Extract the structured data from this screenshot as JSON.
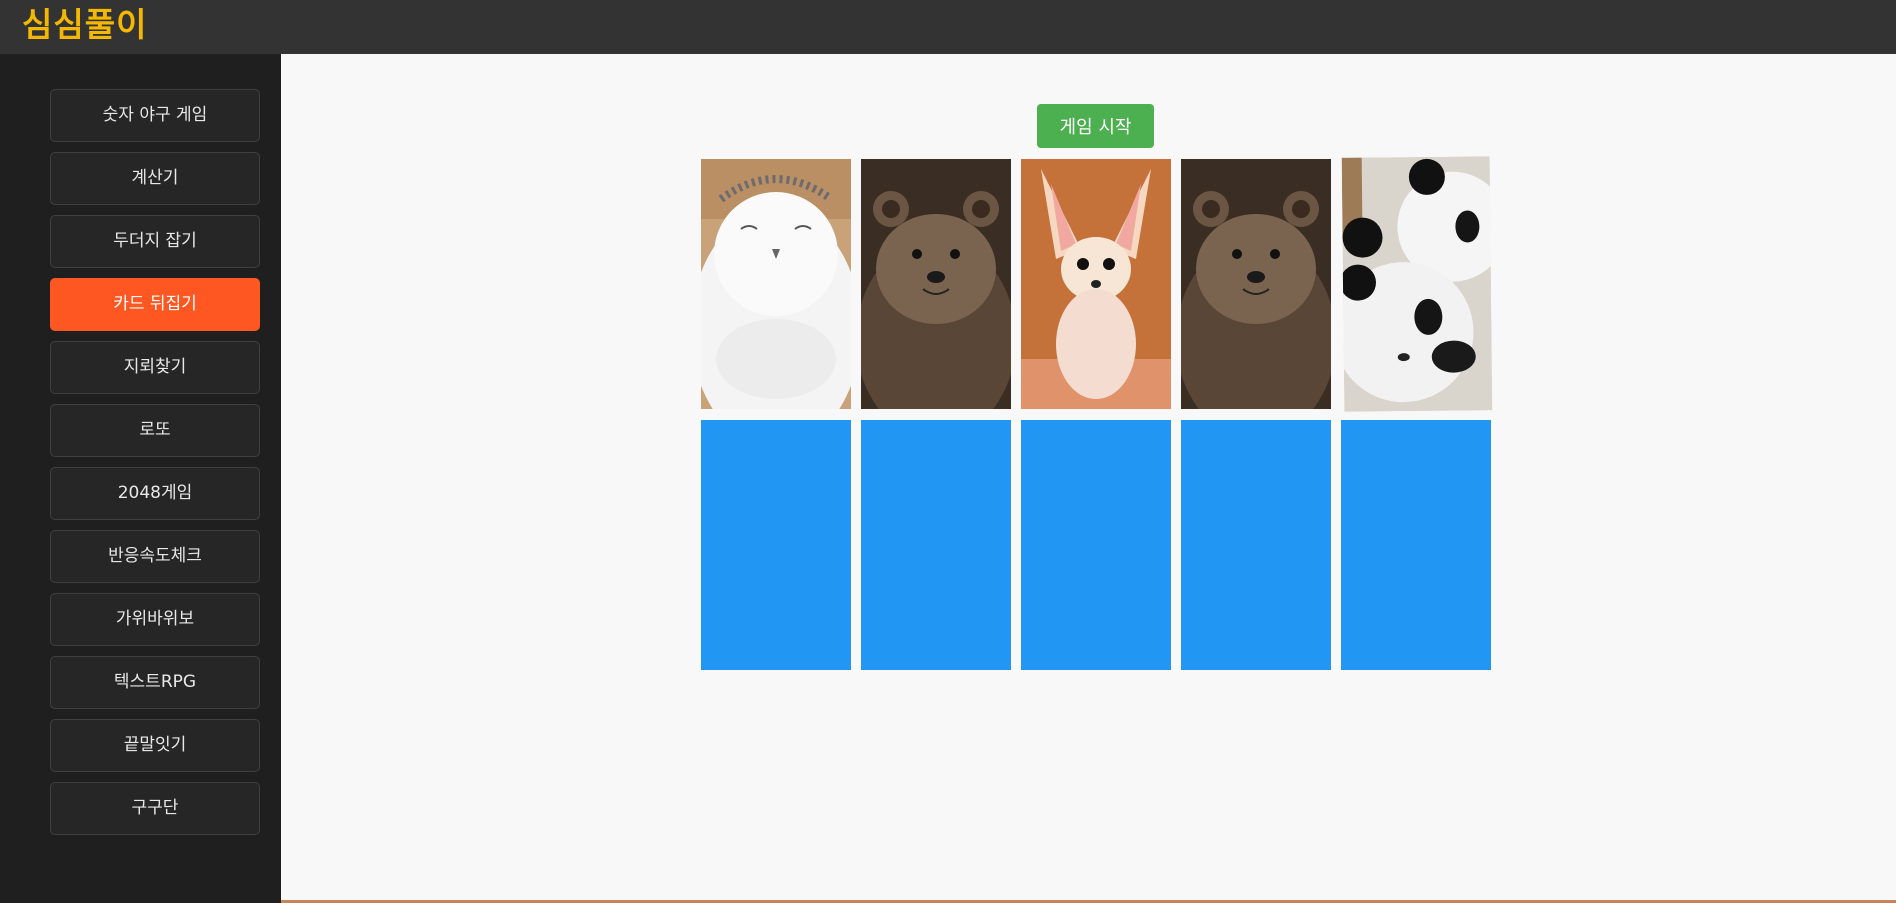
{
  "app": {
    "title": "심심풀이"
  },
  "sidebar": {
    "items": [
      {
        "label": "숫자 야구 게임"
      },
      {
        "label": "계산기"
      },
      {
        "label": "두더지 잡기"
      },
      {
        "label": "카드 뒤집기",
        "active": true
      },
      {
        "label": "지뢰찾기"
      },
      {
        "label": "로또"
      },
      {
        "label": "2048게임"
      },
      {
        "label": "반응속도체크"
      },
      {
        "label": "가위바위보"
      },
      {
        "label": "텍스트RPG"
      },
      {
        "label": "끝말잇기"
      },
      {
        "label": "구구단"
      }
    ]
  },
  "game": {
    "start_label": "게임 시작",
    "cards_row1": [
      {
        "face": "up",
        "image": "snowy-owl"
      },
      {
        "face": "up",
        "image": "quokka"
      },
      {
        "face": "up",
        "image": "fennec-fox"
      },
      {
        "face": "up",
        "image": "quokka"
      },
      {
        "face": "up",
        "image": "panda"
      }
    ],
    "cards_row2": [
      {
        "face": "down"
      },
      {
        "face": "down"
      },
      {
        "face": "down"
      },
      {
        "face": "down"
      },
      {
        "face": "down"
      }
    ]
  },
  "colors": {
    "accent": "#ff5722",
    "logo": "#f5b800",
    "start_button": "#4caf50",
    "card_back": "#2196f3"
  }
}
